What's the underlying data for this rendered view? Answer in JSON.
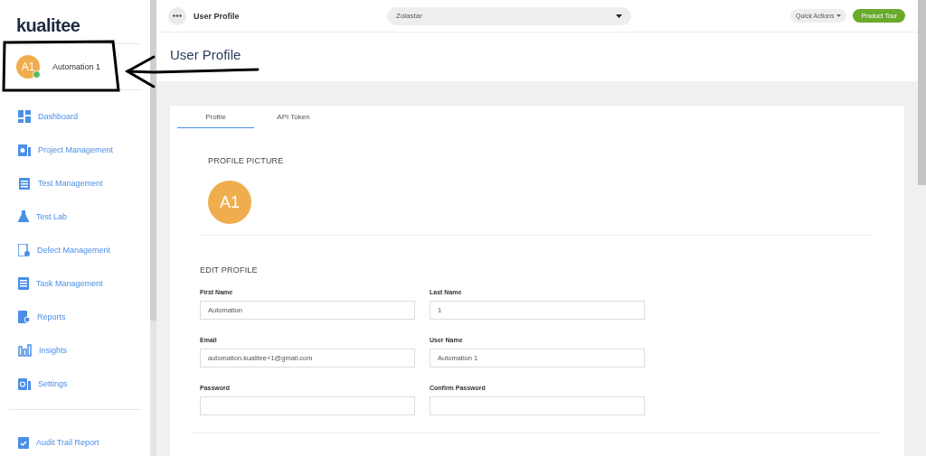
{
  "sidebar": {
    "logo": "kualitee",
    "user": {
      "initials": "A1",
      "name": "Automation 1",
      "online": true
    },
    "items": [
      {
        "label": "Dashboard"
      },
      {
        "label": "Project Management"
      },
      {
        "label": "Test Management"
      },
      {
        "label": "Test Lab"
      },
      {
        "label": "Defect Management"
      },
      {
        "label": "Task Management"
      },
      {
        "label": "Reports"
      },
      {
        "label": "Insights"
      },
      {
        "label": "Settings"
      }
    ],
    "footer_items": [
      {
        "label": "Audit Trail Report"
      }
    ]
  },
  "header": {
    "title": "User Profile",
    "workspace": "Zolastar",
    "quick_actions": "Quick Actions",
    "product_tour": "Product Tour"
  },
  "page_title": "User Profile",
  "tabs": [
    {
      "label": "Profile",
      "selected": true
    },
    {
      "label": "API Token",
      "selected": false
    }
  ],
  "profile_picture": {
    "heading": "PROFILE PICTURE",
    "initials": "A1"
  },
  "edit_profile": {
    "heading": "EDIT PROFILE",
    "fields": [
      {
        "label": "First Name",
        "value": "Automation"
      },
      {
        "label": "Last Name",
        "value": "1"
      },
      {
        "label": "Email",
        "value": "automation.kualitee+1@gmail.com"
      },
      {
        "label": "User Name",
        "value": "Automation 1"
      },
      {
        "label": "Password"
      },
      {
        "label": "Confirm Password"
      }
    ]
  }
}
